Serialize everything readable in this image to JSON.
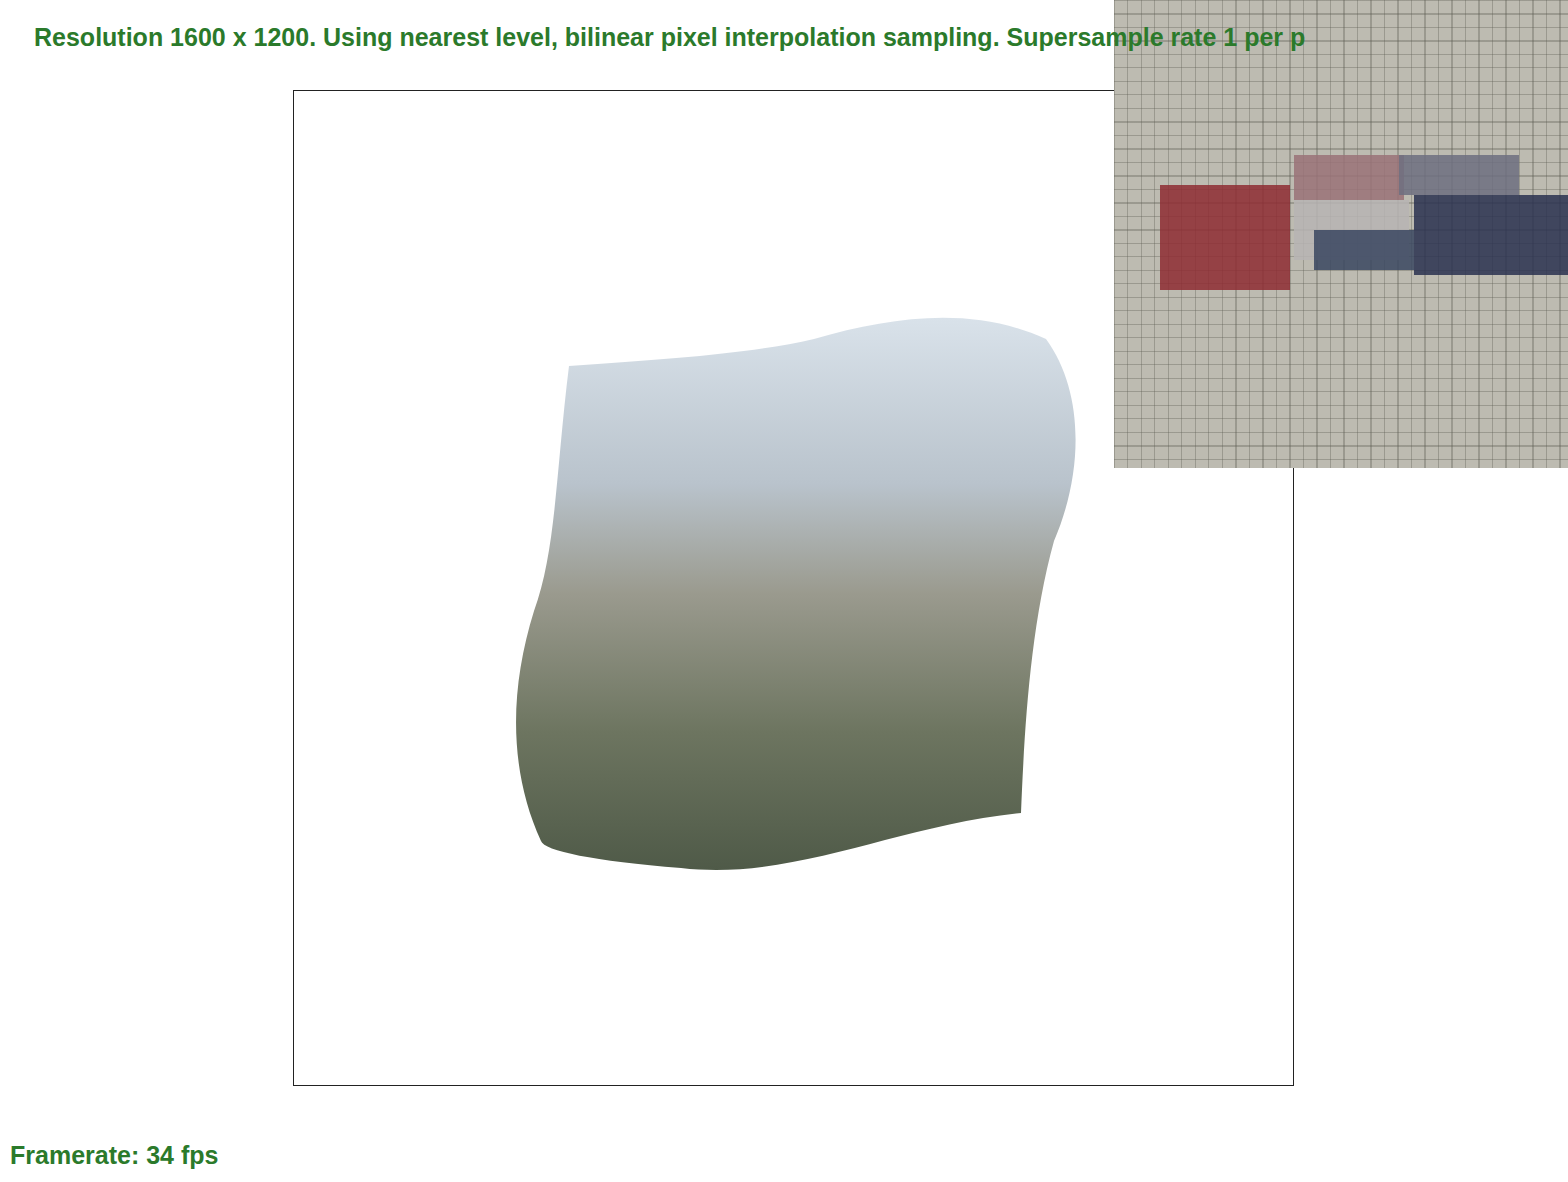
{
  "header": "Resolution 1600 x 1200. Using nearest level, bilinear pixel interpolation sampling. Supersample rate 1 per p",
  "framerate": "Framerate: 34 fps"
}
